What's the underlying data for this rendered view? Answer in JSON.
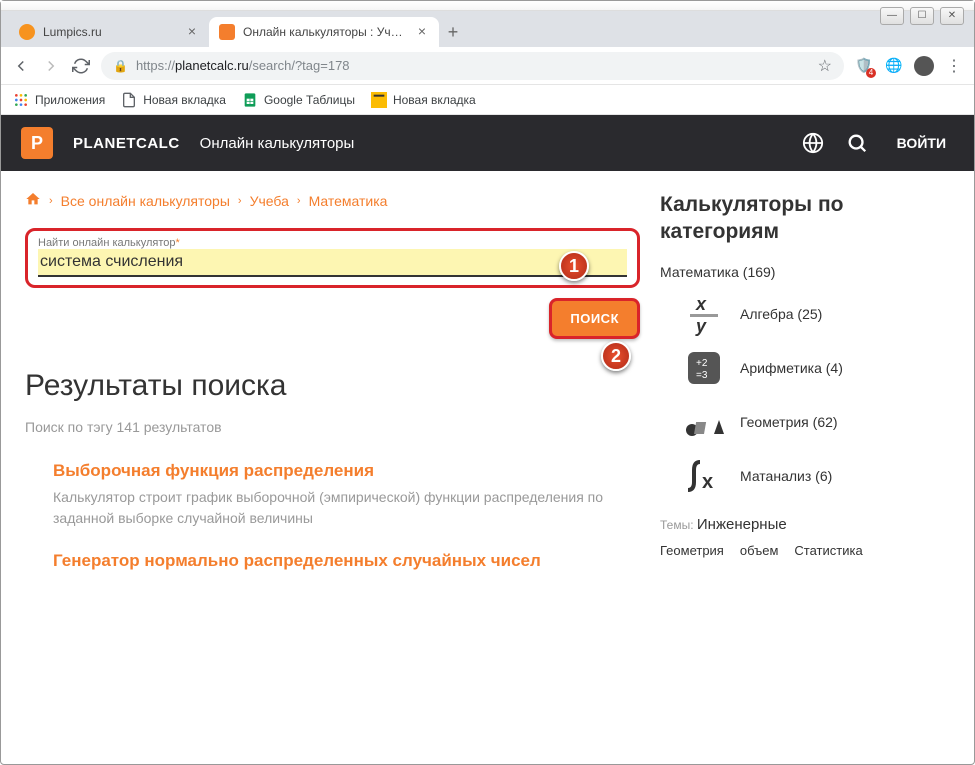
{
  "window": {
    "tabs": [
      {
        "title": "Lumpics.ru",
        "favicon": "#f7931e"
      },
      {
        "title": "Онлайн калькуляторы : Учеба :",
        "favicon": "#f47e2d"
      }
    ],
    "url_prefix": "https://",
    "url_host": "planetcalc.ru",
    "url_path": "/search/?tag=178",
    "bookmarks": [
      {
        "label": "Приложения"
      },
      {
        "label": "Новая вкладка"
      },
      {
        "label": "Google Таблицы"
      },
      {
        "label": "Новая вкладка"
      }
    ]
  },
  "site": {
    "logo_letter": "P",
    "name": "PLANETCALC",
    "tagline": "Онлайн калькуляторы",
    "login": "ВОЙТИ"
  },
  "breadcrumb": [
    "Все онлайн калькуляторы",
    "Учеба",
    "Математика"
  ],
  "search": {
    "label": "Найти онлайн калькулятор",
    "value": "система счисления",
    "button": "ПОИСК"
  },
  "results": {
    "heading": "Результаты поиска",
    "meta": "Поиск по тэгу 141 результатов",
    "items": [
      {
        "title": "Выборочная функция распределения",
        "desc": "Калькулятор строит график выборочной (эмпирической) функции распределения по заданной выборке случайной величины"
      },
      {
        "title": "Генератор нормально распределенных случайных чисел",
        "desc": ""
      }
    ]
  },
  "sidebar": {
    "heading": "Калькуляторы по категориям",
    "main_cat": "Математика (169)",
    "cats": [
      {
        "label": "Алгебра (25)"
      },
      {
        "label": "Арифметика (4)"
      },
      {
        "label": "Геометрия (62)"
      },
      {
        "label": "Матанализ (6)"
      }
    ],
    "tags_label": "Темы:",
    "tags_main": "Инженерные",
    "tag_row": [
      "Геометрия",
      "объем",
      "Статистика"
    ]
  },
  "markers": {
    "one": "1",
    "two": "2"
  }
}
